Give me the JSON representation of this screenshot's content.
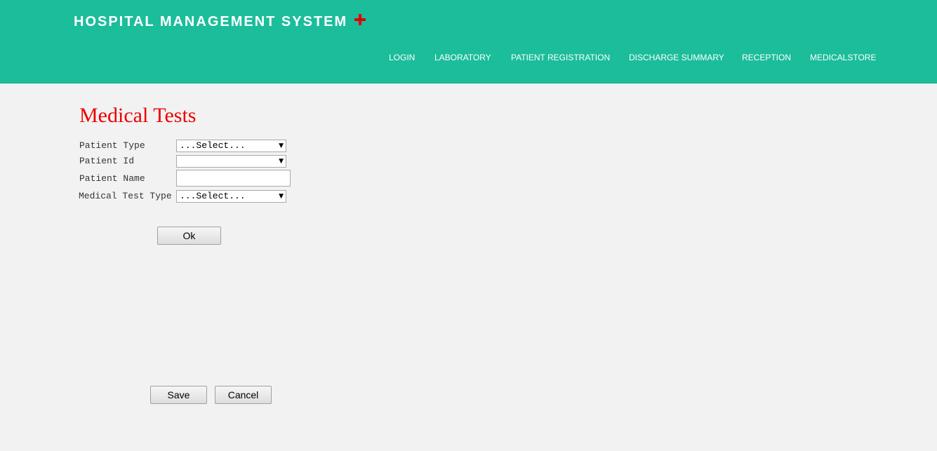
{
  "header": {
    "brand": "HOSPITAL MANAGEMENT SYSTEM",
    "brand_icon": "plus-icon",
    "accent_color": "#1bbd9b",
    "icon_color": "#ee0000",
    "nav": {
      "login": "LOGIN",
      "laboratory": "LABORATORY",
      "patient_registration": "PATIENT REGISTRATION",
      "discharge_summary": "DISCHARGE SUMMARY",
      "reception": "RECEPTION",
      "medicalstore": "MEDICALSTORE"
    }
  },
  "main": {
    "title": "Medical Tests",
    "form": {
      "patient_type_label": "Patient Type",
      "patient_type_value": "...Select...",
      "patient_id_label": "Patient Id",
      "patient_id_value": "",
      "patient_name_label": "Patient Name",
      "patient_name_value": "",
      "medical_test_type_label": "Medical Test Type",
      "medical_test_type_value": "...Select..."
    },
    "buttons": {
      "ok": "Ok",
      "save": "Save",
      "cancel": "Cancel"
    }
  }
}
